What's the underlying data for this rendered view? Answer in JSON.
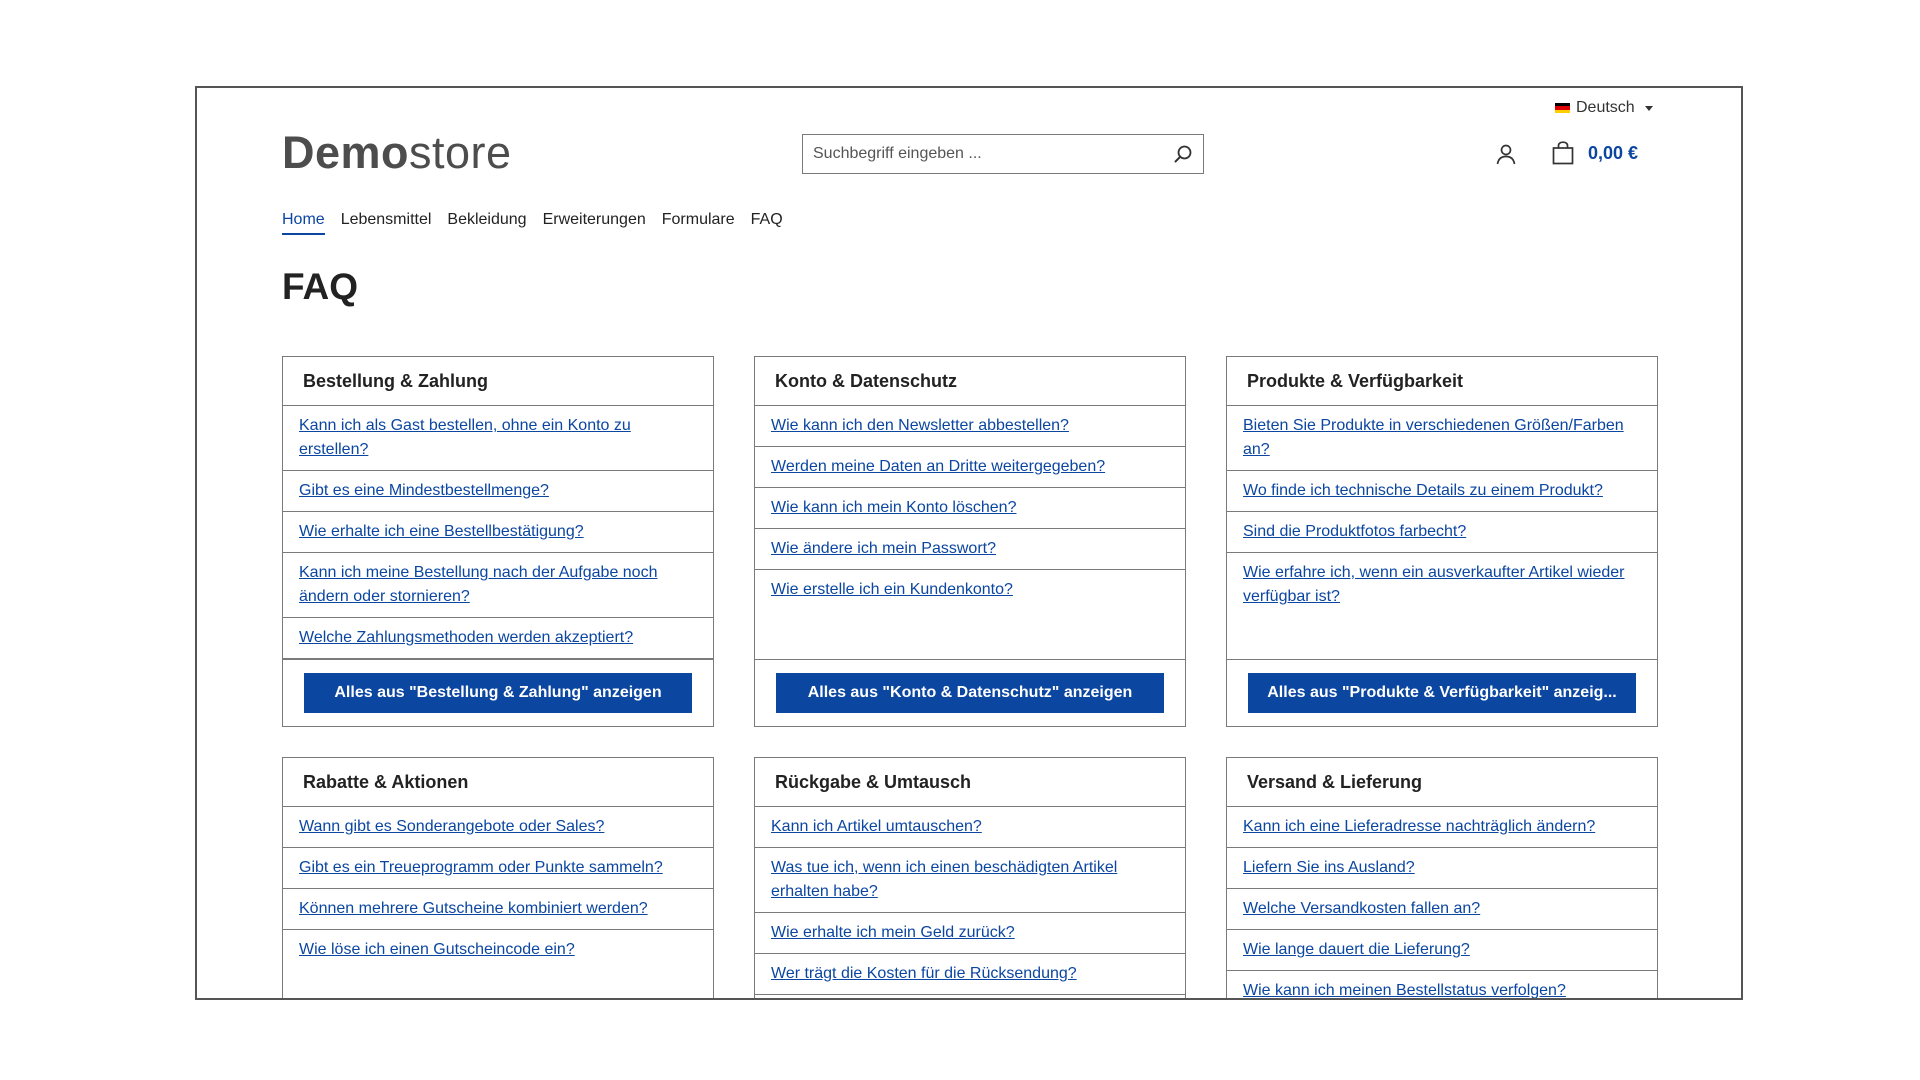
{
  "language": {
    "label": "Deutsch",
    "flag_colors": [
      "#000000",
      "#dd0000",
      "#ffce00"
    ]
  },
  "logo": {
    "bold": "Demo",
    "regular": "store"
  },
  "search": {
    "placeholder": "Suchbegriff eingeben ..."
  },
  "cart": {
    "total": "0,00 €"
  },
  "nav": [
    "Home",
    "Lebensmittel",
    "Bekleidung",
    "Erweiterungen",
    "Formulare",
    "FAQ"
  ],
  "nav_active": "Home",
  "page_title": "FAQ",
  "colors": {
    "accent": "#0b46a1",
    "border": "#7a7a7a"
  },
  "cards": [
    {
      "title": "Bestellung & Zahlung",
      "items": [
        "Kann ich als Gast bestellen, ohne ein Konto zu erstellen?",
        "Gibt es eine Mindestbestellmenge?",
        "Wie erhalte ich eine Bestellbestätigung?",
        "Kann ich meine Bestellung nach der Aufgabe noch ändern oder stornieren?",
        "Welche Zahlungsmethoden werden akzeptiert?"
      ],
      "button": "Alles aus \"Bestellung & Zahlung\" anzeigen"
    },
    {
      "title": "Konto & Datenschutz",
      "items": [
        "Wie kann ich den Newsletter abbestellen?",
        "Werden meine Daten an Dritte weitergegeben?",
        "Wie kann ich mein Konto löschen?",
        "Wie ändere ich mein Passwort?",
        "Wie erstelle ich ein Kundenkonto?"
      ],
      "button": "Alles aus \"Konto & Datenschutz\" anzeigen"
    },
    {
      "title": "Produkte & Verfügbarkeit",
      "items": [
        "Bieten Sie Produkte in verschiedenen Größen/Farben an?",
        "Wo finde ich technische Details zu einem Produkt?",
        "Sind die Produktfotos farbecht?",
        "Wie erfahre ich, wenn ein ausverkaufter Artikel wieder verfügbar ist?"
      ],
      "button": "Alles aus \"Produkte & Verfügbarkeit\" anzeig..."
    },
    {
      "title": "Rabatte & Aktionen",
      "items": [
        "Wann gibt es Sonderangebote oder Sales?",
        "Gibt es ein Treueprogramm oder Punkte sammeln?",
        "Können mehrere Gutscheine kombiniert werden?",
        "Wie löse ich einen Gutscheincode ein?"
      ],
      "button": ""
    },
    {
      "title": "Rückgabe & Umtausch",
      "items": [
        "Kann ich Artikel umtauschen?",
        "Was tue ich, wenn ich einen beschädigten Artikel erhalten habe?",
        "Wie erhalte ich mein Geld zurück?",
        "Wer trägt die Kosten für die Rücksendung?"
      ],
      "button": ""
    },
    {
      "title": "Versand & Lieferung",
      "items": [
        "Kann ich eine Lieferadresse nachträglich ändern?",
        "Liefern Sie ins Ausland?",
        "Welche Versandkosten fallen an?",
        "Wie lange dauert die Lieferung?",
        "Wie kann ich meinen Bestellstatus verfolgen?"
      ],
      "button": ""
    }
  ]
}
